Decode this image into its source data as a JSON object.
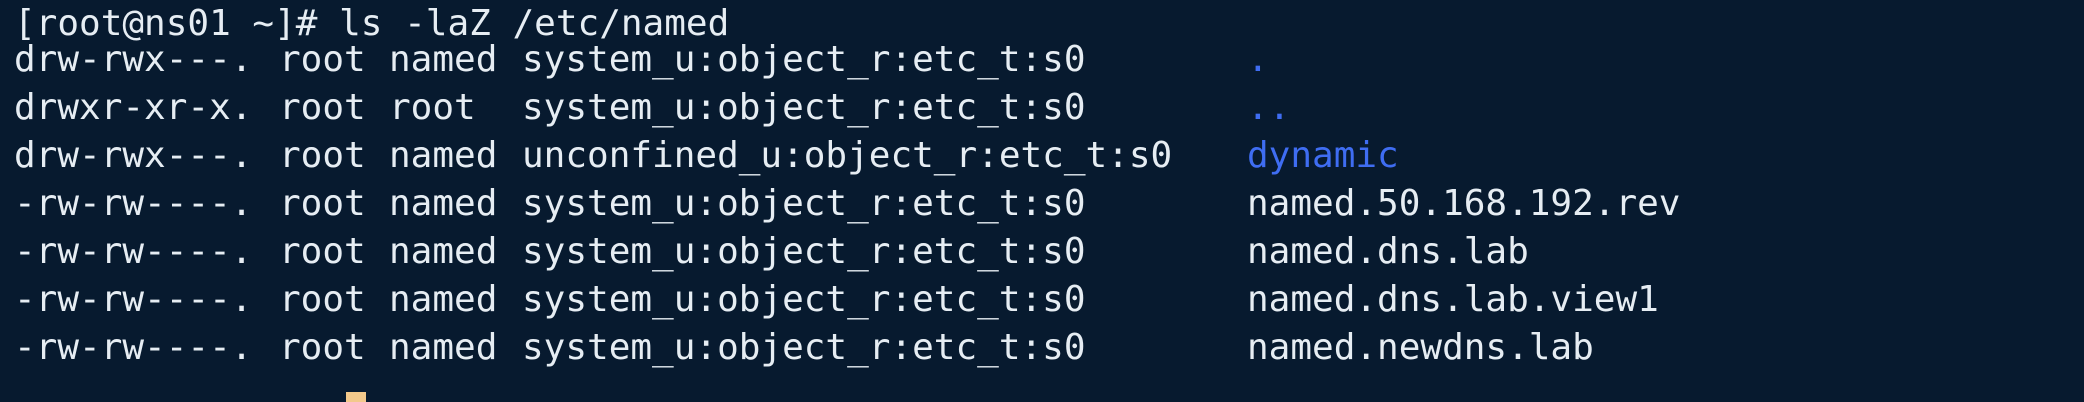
{
  "terminal": {
    "prompt_line": "[root@ns01 ~]# ls -laZ /etc/named",
    "entries": [
      {
        "perm": "drw-rwx---.",
        "owner": "root",
        "group": "named",
        "context": "system_u:object_r:etc_t:s0",
        "name": "."
      },
      {
        "perm": "drwxr-xr-x.",
        "owner": "root",
        "group": "root",
        "context": "system_u:object_r:etc_t:s0",
        "name": ".."
      },
      {
        "perm": "drw-rwx---.",
        "owner": "root",
        "group": "named",
        "context": "unconfined_u:object_r:etc_t:s0",
        "name": "dynamic"
      },
      {
        "perm": "-rw-rw----.",
        "owner": "root",
        "group": "named",
        "context": "system_u:object_r:etc_t:s0",
        "name": "named.50.168.192.rev"
      },
      {
        "perm": "-rw-rw----.",
        "owner": "root",
        "group": "named",
        "context": "system_u:object_r:etc_t:s0",
        "name": "named.dns.lab"
      },
      {
        "perm": "-rw-rw----.",
        "owner": "root",
        "group": "named",
        "context": "system_u:object_r:etc_t:s0",
        "name": "named.dns.lab.view1"
      },
      {
        "perm": "-rw-rw----.",
        "owner": "root",
        "group": "named",
        "context": "system_u:object_r:etc_t:s0",
        "name": "named.newdns.lab"
      }
    ],
    "colors": {
      "background": "#071a2f",
      "text": "#e6edf3",
      "directory": "#3f6df2",
      "cursor": "#f3c98b"
    }
  }
}
